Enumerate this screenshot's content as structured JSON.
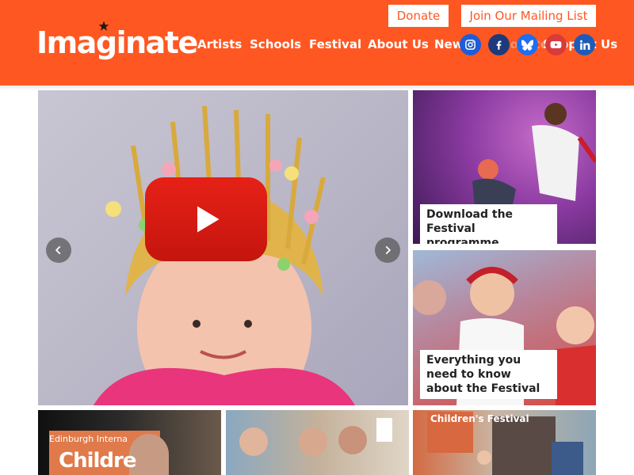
{
  "header": {
    "logo_text": "Imaginate",
    "donate_label": "Donate",
    "mailing_list_label": "Join Our Mailing List",
    "nav": [
      "Artists",
      "Schools",
      "Festival",
      "About Us",
      "News",
      "Donate",
      "Support Us"
    ],
    "social": [
      {
        "name": "instagram-icon",
        "color": "#1e5dd8"
      },
      {
        "name": "facebook-icon",
        "color": "#1e3a7b"
      },
      {
        "name": "bluesky-icon",
        "color": "#1e6ef0"
      },
      {
        "name": "youtube-icon",
        "color": "#d93a3a"
      },
      {
        "name": "linkedin-icon",
        "color": "#1e5bb8"
      }
    ],
    "colors": {
      "brand": "#ff5722",
      "text": "#ffffff"
    }
  },
  "hero": {
    "video_icon": "play-icon",
    "prev_icon": "chevron-left-icon",
    "next_icon": "chevron-right-icon"
  },
  "cards": [
    {
      "label": "Download the Festival programme"
    },
    {
      "label": "Everything you need to know about the Festival"
    }
  ],
  "thumbnails": [
    {
      "text_small": "Edinburgh Interna",
      "text_large": "Childre"
    },
    {
      "text_small": "",
      "text_large": ""
    },
    {
      "text_small": "",
      "text_large": "Children's Festival"
    }
  ]
}
